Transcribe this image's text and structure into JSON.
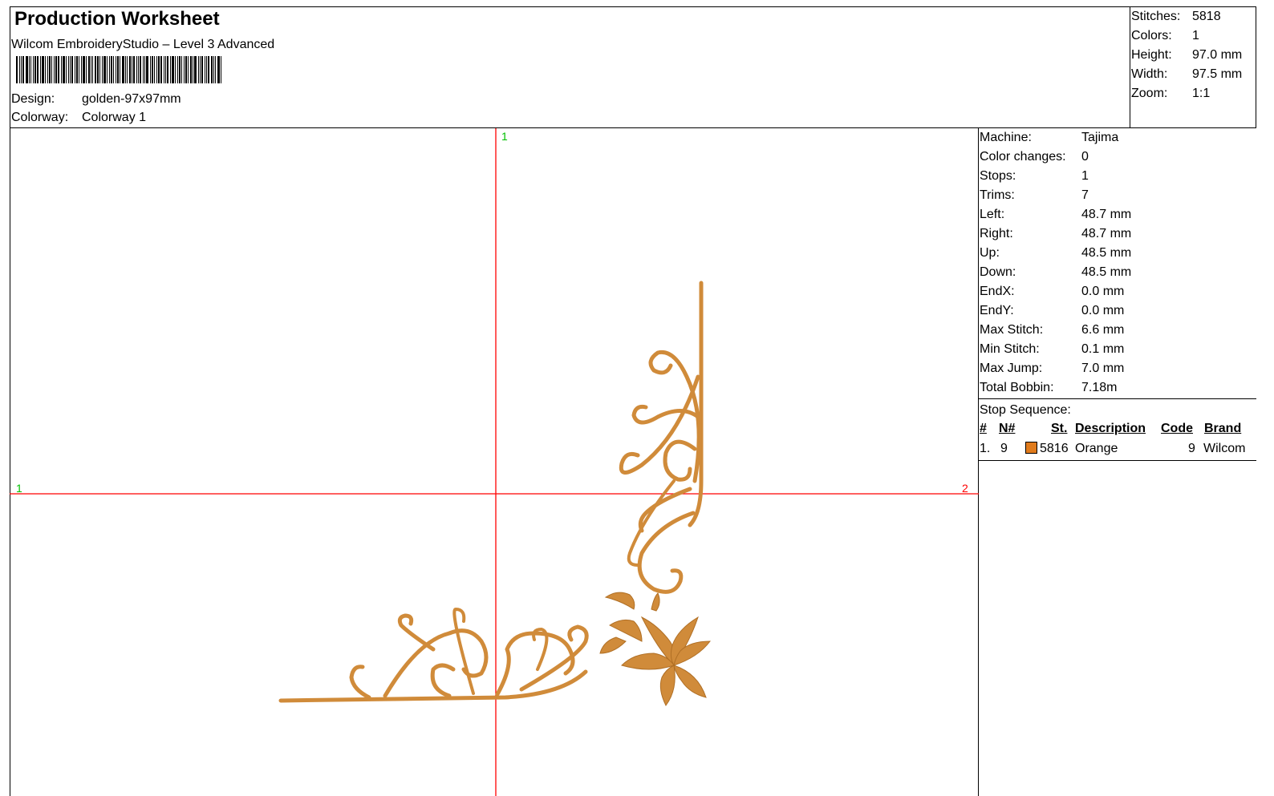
{
  "header": {
    "title": "Production Worksheet",
    "subtitle": "Wilcom EmbroideryStudio – Level 3 Advanced",
    "design_label": "Design:",
    "design_value": "golden-97x97mm",
    "colorway_label": "Colorway:",
    "colorway_value": "Colorway 1"
  },
  "summary": [
    {
      "label": "Stitches:",
      "value": "5818"
    },
    {
      "label": "Colors:",
      "value": "1"
    },
    {
      "label": "Height:",
      "value": "97.0 mm"
    },
    {
      "label": "Width:",
      "value": "97.5 mm"
    },
    {
      "label": "Zoom:",
      "value": "1:1"
    }
  ],
  "machine_info": [
    {
      "label": "Machine:",
      "value": "Tajima"
    },
    {
      "label": "Color changes:",
      "value": "0"
    },
    {
      "label": "Stops:",
      "value": "1"
    },
    {
      "label": "Trims:",
      "value": "7"
    },
    {
      "label": "Left:",
      "value": "48.7 mm"
    },
    {
      "label": "Right:",
      "value": "48.7 mm"
    },
    {
      "label": "Up:",
      "value": "48.5 mm"
    },
    {
      "label": "Down:",
      "value": "48.5 mm"
    },
    {
      "label": "EndX:",
      "value": "0.0 mm"
    },
    {
      "label": "EndY:",
      "value": "0.0 mm"
    },
    {
      "label": "Max Stitch:",
      "value": "6.6 mm"
    },
    {
      "label": "Min Stitch:",
      "value": "0.1 mm"
    },
    {
      "label": "Max Jump:",
      "value": "7.0 mm"
    },
    {
      "label": "Total Bobbin:",
      "value": "7.18m"
    }
  ],
  "stop_sequence": {
    "title": "Stop Sequence:",
    "columns": [
      "#",
      "N#",
      "St.",
      "Description",
      "Code",
      "Brand"
    ],
    "rows": [
      {
        "num": "1.",
        "needle": "9",
        "stitches": "5816",
        "description": "Orange",
        "code": "9",
        "brand": "Wilcom",
        "color": "#e07b1c"
      }
    ]
  },
  "axis_markers": {
    "top": "1",
    "left": "1",
    "right": "2"
  },
  "colors": {
    "thread": "#d08b3a",
    "thread_shade": "#b06f25",
    "axis": "#ff0000",
    "marker_green": "#00c000",
    "marker_red": "#ff0000"
  }
}
